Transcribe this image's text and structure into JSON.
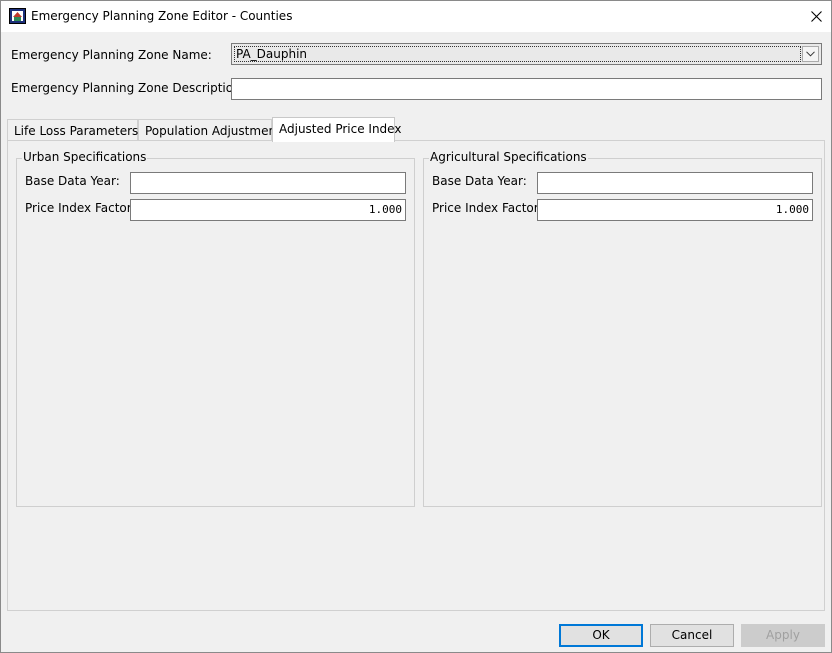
{
  "window": {
    "title": "Emergency Planning Zone Editor - Counties",
    "icon": "app-icon",
    "close_icon": "close-icon"
  },
  "form": {
    "zone_name_label": "Emergency Planning Zone Name:",
    "zone_name_value": "PA_Dauphin",
    "zone_description_label": "Emergency Planning Zone Description:",
    "zone_description_value": ""
  },
  "tabs": [
    {
      "label": "Life Loss Parameters",
      "active": false
    },
    {
      "label": "Population Adjustment",
      "active": false
    },
    {
      "label": "Adjusted Price Index",
      "active": true
    }
  ],
  "urban": {
    "title": "Urban Specifications",
    "base_year_label": "Base Data Year:",
    "base_year_value": "",
    "price_index_label": "Price Index Factor:",
    "price_index_value": "1.000"
  },
  "agricultural": {
    "title": "Agricultural Specifications",
    "base_year_label": "Base Data Year:",
    "base_year_value": "",
    "price_index_label": "Price Index Factor:",
    "price_index_value": "1.000"
  },
  "buttons": {
    "ok": "OK",
    "cancel": "Cancel",
    "apply": "Apply"
  }
}
